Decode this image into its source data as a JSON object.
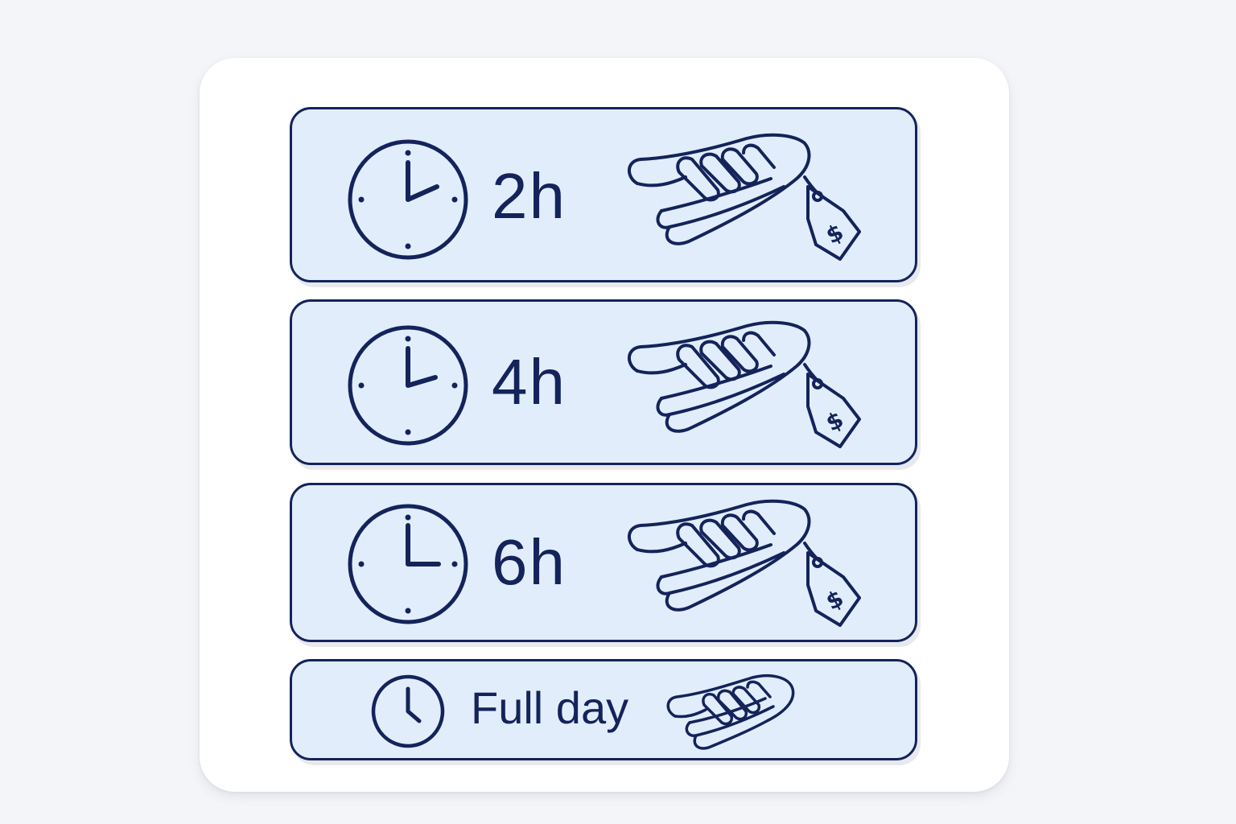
{
  "duration_options": [
    {
      "label": "2h",
      "icon": "clock-icon",
      "price_icon": "price-tag-icon"
    },
    {
      "label": "4h",
      "icon": "clock-icon",
      "price_icon": "price-tag-icon"
    },
    {
      "label": "6h",
      "icon": "clock-icon",
      "price_icon": "price-tag-icon"
    },
    {
      "label": "Full day",
      "icon": "clock-icon",
      "price_icon": "hand-icon"
    }
  ],
  "price_tag": {
    "symbol": "$"
  },
  "colors": {
    "ink": "#14235a",
    "option_fill": "#e1edfb",
    "card": "#ffffff",
    "background": "#f4f5f8"
  }
}
